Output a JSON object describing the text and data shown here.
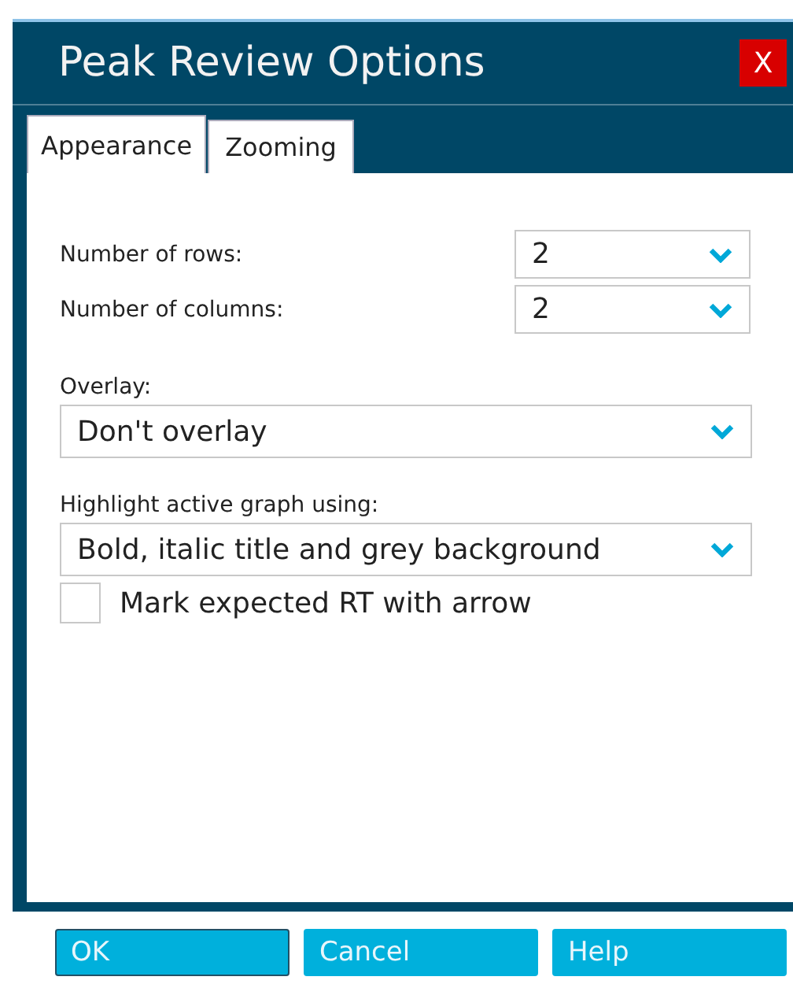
{
  "window": {
    "title": "Peak Review Options",
    "close": "X"
  },
  "tabs": [
    {
      "label": "Appearance",
      "selected": true
    },
    {
      "label": "Zooming",
      "selected": false
    }
  ],
  "grid_fields": [
    {
      "label": "Number of rows:",
      "value": "2"
    },
    {
      "label": "Number of columns:",
      "value": "2"
    }
  ],
  "overlay": {
    "label": "Overlay:",
    "value": "Don't overlay"
  },
  "highlight": {
    "label": "Highlight active graph using:",
    "value": "Bold, italic title and grey background"
  },
  "mark_rt": {
    "label": "Mark expected RT with arrow",
    "checked": false
  },
  "buttons": [
    {
      "label": "OK",
      "default": true
    },
    {
      "label": "Cancel",
      "default": false
    },
    {
      "label": "Help",
      "default": false
    }
  ]
}
